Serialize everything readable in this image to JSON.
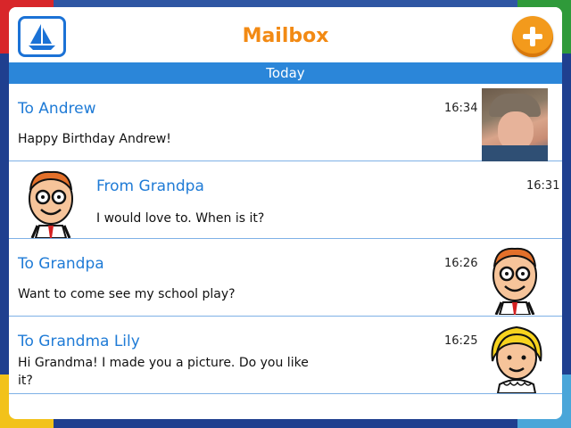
{
  "header": {
    "title": "Mailbox",
    "section": "Today"
  },
  "messages": [
    {
      "title": "To Andrew",
      "body": "Happy Birthday Andrew!",
      "time": "16:34",
      "avatar": "photo-andrew"
    },
    {
      "title": "From Grandpa",
      "body": "I would love to. When is it?",
      "time": "16:31",
      "avatar": "grandpa-icon"
    },
    {
      "title": "To Grandpa",
      "body": "Want to come see my school play?",
      "time": "16:26",
      "avatar": "grandpa-icon"
    },
    {
      "title": "To Grandma Lily",
      "body": "Hi Grandma! I made you a picture. Do you like it?",
      "time": "16:25",
      "avatar": "grandma-icon"
    }
  ],
  "colors": {
    "accent_orange": "#f28a14",
    "accent_blue": "#2b86d9",
    "title_blue": "#1f7bd6"
  }
}
